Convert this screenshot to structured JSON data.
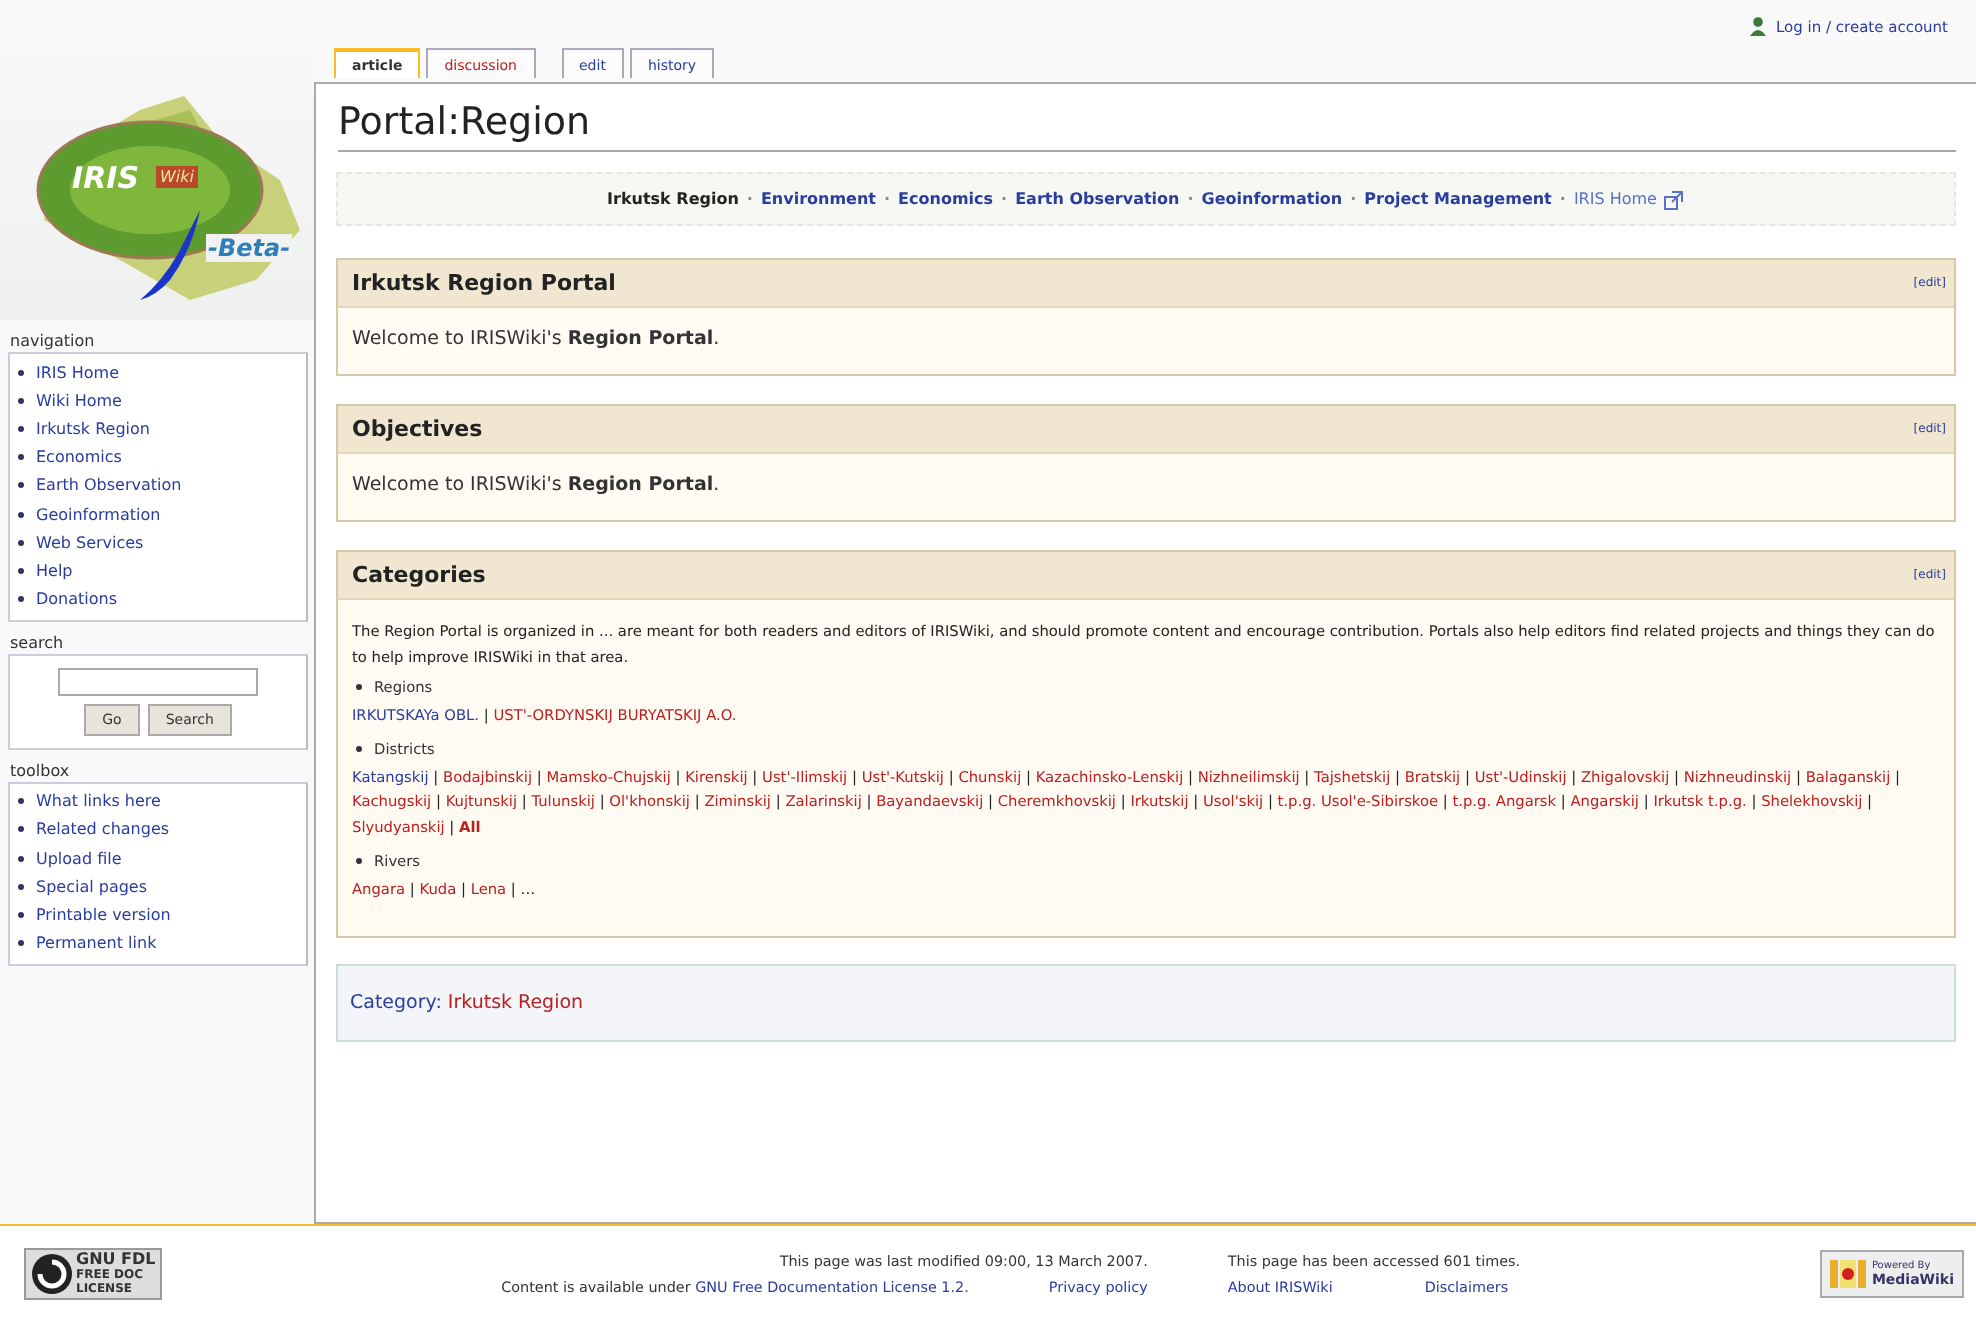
{
  "personal_tools": {
    "label": "Log in / create account"
  },
  "logo": {
    "name": "IRIS",
    "suffix": "Wiki",
    "tag": "-Beta-"
  },
  "sidebar": {
    "navigation": {
      "title": "navigation",
      "items": [
        "IRIS Home",
        "Wiki Home",
        "Irkutsk Region",
        "Economics",
        "Earth Observation",
        "Geoinformation",
        "Web Services",
        "Help",
        "Donations"
      ]
    },
    "search": {
      "title": "search",
      "buttons": [
        "Go",
        "Search"
      ]
    },
    "toolbox": {
      "title": "toolbox",
      "items": [
        "What links here",
        "Related changes",
        "Upload file",
        "Special pages",
        "Printable version",
        "Permanent link"
      ]
    }
  },
  "tabs": [
    {
      "label": "article",
      "selected": true,
      "missing": false
    },
    {
      "label": "discussion",
      "selected": false,
      "missing": true
    },
    {
      "label": "edit",
      "selected": false,
      "missing": false
    },
    {
      "label": "history",
      "selected": false,
      "missing": false
    }
  ],
  "page_title": "Portal:Region",
  "portal_nav": {
    "separator": "·",
    "items": [
      {
        "label": "Irkutsk Region",
        "current": true,
        "external": false
      },
      {
        "label": "Environment",
        "current": false,
        "external": false
      },
      {
        "label": "Economics",
        "current": false,
        "external": false
      },
      {
        "label": "Earth Observation",
        "current": false,
        "external": false
      },
      {
        "label": "Geoinformation",
        "current": false,
        "external": false
      },
      {
        "label": "Project Management",
        "current": false,
        "external": false
      },
      {
        "label": "IRIS Home",
        "current": false,
        "external": true
      }
    ]
  },
  "boxes": [
    {
      "kind": "text",
      "title": "Irkutsk Region Portal",
      "edit": "[edit]",
      "text": "Welcome to IRISWiki's **Region Portal**."
    },
    {
      "kind": "text",
      "title": "Objectives",
      "edit": "[edit]",
      "text": "Welcome to IRISWiki's **Region Portal**."
    },
    {
      "kind": "categories",
      "title": "Categories",
      "edit": "[edit]",
      "intro": "The Region Portal is organized in ... are meant for both readers and editors of IRISWiki, and should promote content and encourage contribution. Portals also help editors find related projects and things they can do to help improve IRISWiki in that area.",
      "separator": "|",
      "groups": [
        {
          "heading": "Regions",
          "links": [
            {
              "label": "IRKUTSKAYa OBL.",
              "missing": false
            },
            {
              "label": "UST'-ORDYNSKIJ BURYATSKIJ A.O.",
              "missing": true
            }
          ]
        },
        {
          "heading": "Districts",
          "all_link": {
            "label": "All",
            "missing": true
          },
          "links": [
            {
              "label": "Katangskij",
              "missing": false
            },
            {
              "label": "Bodajbinskij",
              "missing": true
            },
            {
              "label": "Mamsko-Chujskij",
              "missing": true
            },
            {
              "label": "Kirenskij",
              "missing": true
            },
            {
              "label": "Ust'-Ilimskij",
              "missing": true
            },
            {
              "label": "Ust'-Kutskij",
              "missing": true
            },
            {
              "label": "Chunskij",
              "missing": true
            },
            {
              "label": "Kazachinsko-Lenskij",
              "missing": true
            },
            {
              "label": "Nizhneilimskij",
              "missing": true
            },
            {
              "label": "Tajshetskij",
              "missing": true
            },
            {
              "label": "Bratskij",
              "missing": true
            },
            {
              "label": "Ust'-Udinskij",
              "missing": true
            },
            {
              "label": "Zhigalovskij",
              "missing": true
            },
            {
              "label": "Nizhneudinskij",
              "missing": true
            },
            {
              "label": "Balaganskij",
              "missing": true
            },
            {
              "label": "Kachugskij",
              "missing": true
            },
            {
              "label": "Kujtunskij",
              "missing": true
            },
            {
              "label": "Tulunskij",
              "missing": true
            },
            {
              "label": "Ol'khonskij",
              "missing": true
            },
            {
              "label": "Ziminskij",
              "missing": true
            },
            {
              "label": "Zalarinskij",
              "missing": true
            },
            {
              "label": "Bayandaevskij",
              "missing": true
            },
            {
              "label": "Cheremkhovskij",
              "missing": true
            },
            {
              "label": "Irkutskij",
              "missing": true
            },
            {
              "label": "Usol'skij",
              "missing": true
            },
            {
              "label": "t.p.g. Usol'e-Sibirskoe",
              "missing": true
            },
            {
              "label": "t.p.g. Angarsk",
              "missing": true
            },
            {
              "label": "Angarskij",
              "missing": true
            },
            {
              "label": "Irkutsk t.p.g.",
              "missing": true
            },
            {
              "label": "Shelekhovskij",
              "missing": true
            },
            {
              "label": "Slyudyanskij",
              "missing": true
            }
          ]
        },
        {
          "heading": "Rivers",
          "more": "…",
          "links": [
            {
              "label": "Angara",
              "missing": true
            },
            {
              "label": "Kuda",
              "missing": true
            },
            {
              "label": "Lena",
              "missing": true
            }
          ]
        }
      ]
    }
  ],
  "catlinks": {
    "label": "Category:",
    "category": {
      "label": "Irkutsk Region",
      "missing": true
    }
  },
  "footer": {
    "fdl_badge": [
      "GNU FDL",
      "FREE DOC",
      "LICENSE"
    ],
    "modified": "This page was last modified 09:00, 13 March 2007.",
    "accessed": "This page has been accessed 601 times.",
    "license_prefix": "Content is available under",
    "license_link": "GNU Free Documentation License 1.2.",
    "links": [
      "Privacy policy",
      "About IRISWiki",
      "Disclaimers"
    ],
    "powered_badge": [
      "Powered By",
      "MediaWiki"
    ]
  }
}
